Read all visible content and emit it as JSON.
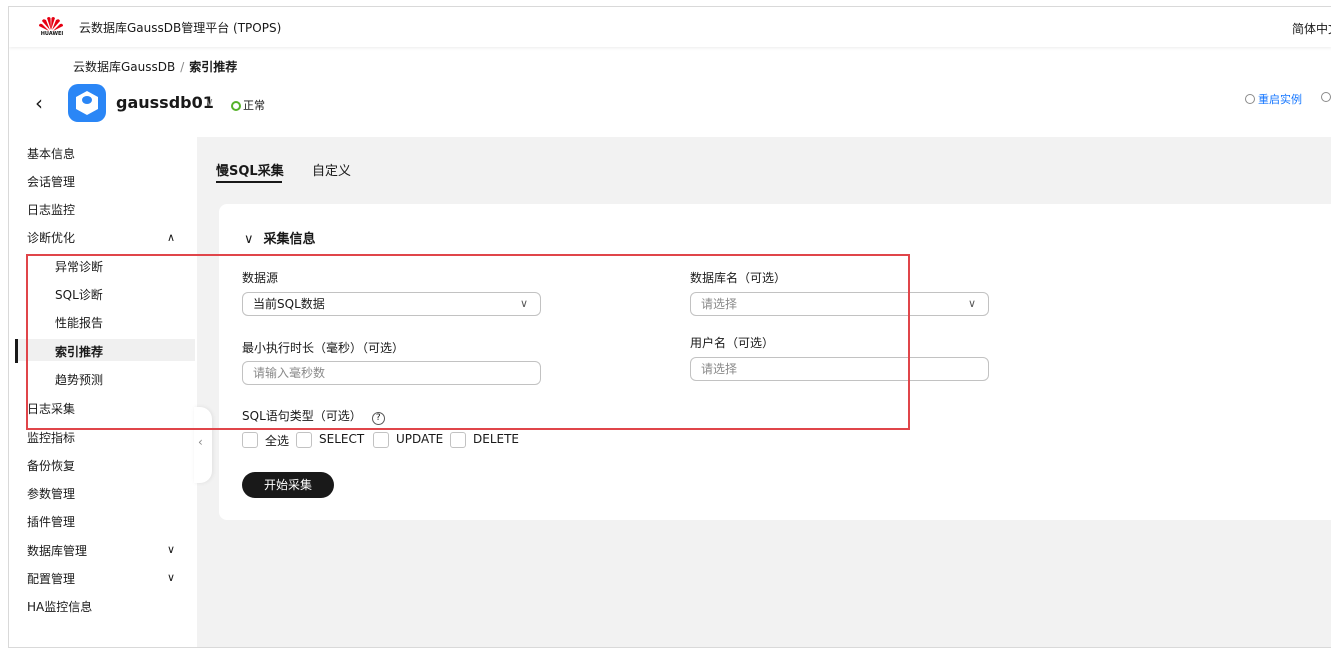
{
  "header": {
    "logo_text": "HUAWEI",
    "app_title": "云数据库GaussDB管理平台 (TPOPS)",
    "language": "简体中文"
  },
  "breadcrumb": {
    "parent": "云数据库GaussDB",
    "separator": "/",
    "current": "索引推荐"
  },
  "instance": {
    "name": "gaussdb01",
    "icon_text": "GaussDB",
    "status": "正常",
    "status_color": "#55b22a",
    "restart_label": "重启实例"
  },
  "sidebar": {
    "items": [
      {
        "label": "基本信息"
      },
      {
        "label": "会话管理"
      },
      {
        "label": "日志监控"
      },
      {
        "label": "诊断优化",
        "expanded": true
      },
      {
        "label": "异常诊断"
      },
      {
        "label": "SQL诊断"
      },
      {
        "label": "性能报告"
      },
      {
        "label": "索引推荐",
        "active": true
      },
      {
        "label": "趋势预测"
      },
      {
        "label": "日志采集"
      },
      {
        "label": "监控指标"
      },
      {
        "label": "备份恢复"
      },
      {
        "label": "参数管理"
      },
      {
        "label": "插件管理"
      },
      {
        "label": "数据库管理",
        "expandable": true
      },
      {
        "label": "配置管理",
        "expandable": true
      },
      {
        "label": "HA监控信息"
      }
    ]
  },
  "tabs": [
    {
      "label": "慢SQL采集",
      "active": true
    },
    {
      "label": "自定义"
    }
  ],
  "form": {
    "section_title": "采集信息",
    "datasource": {
      "label": "数据源",
      "value": "当前SQL数据"
    },
    "database": {
      "label": "数据库名（可选）",
      "placeholder": "请选择"
    },
    "min_exec": {
      "label": "最小执行时长（毫秒）（可选）",
      "placeholder": "请输入毫秒数"
    },
    "username": {
      "label": "用户名（可选）",
      "placeholder": "请选择"
    },
    "sql_type": {
      "label": "SQL语句类型（可选）",
      "options": [
        "全选",
        "SELECT",
        "UPDATE",
        "DELETE"
      ]
    },
    "start_button": "开始采集"
  },
  "colors": {
    "accent": "#1476ff",
    "highlight": "#e0454a",
    "primary_button": "#191919"
  }
}
